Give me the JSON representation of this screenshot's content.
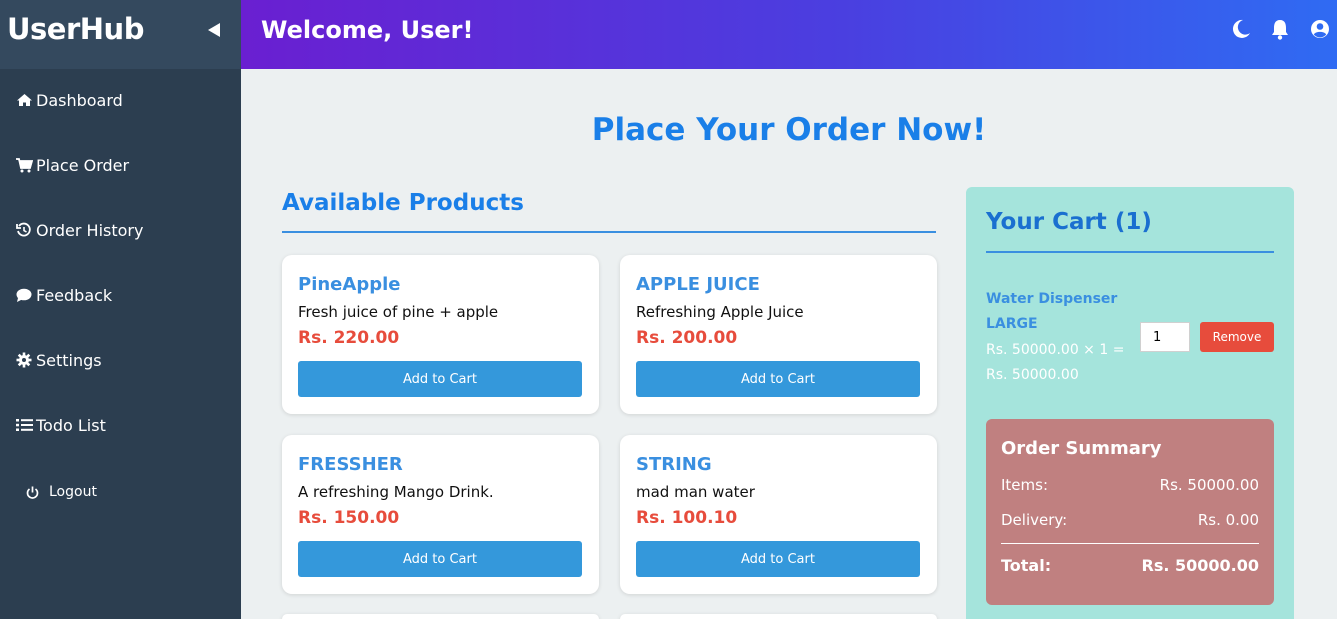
{
  "app": {
    "brand": "UserHub",
    "welcome": "Welcome, User!"
  },
  "sidebar": {
    "items": [
      {
        "label": "Dashboard",
        "icon": "home-icon"
      },
      {
        "label": "Place Order",
        "icon": "cart-icon"
      },
      {
        "label": "Order History",
        "icon": "history-icon"
      },
      {
        "label": "Feedback",
        "icon": "comment-icon"
      },
      {
        "label": "Settings",
        "icon": "gear-icon"
      },
      {
        "label": "Todo List",
        "icon": "list-icon"
      }
    ],
    "logout": {
      "label": "Logout",
      "icon": "power-icon"
    }
  },
  "topbar": {
    "icons": [
      "moon-icon",
      "bell-icon",
      "user-circle-icon"
    ]
  },
  "main": {
    "title": "Place Your Order Now!",
    "products_title": "Available Products",
    "add_label": "Add to Cart",
    "products": [
      {
        "name": "PineApple",
        "desc": "Fresh juice of pine + apple",
        "price": "Rs. 220.00"
      },
      {
        "name": "APPLE JUICE",
        "desc": "Refreshing Apple Juice",
        "price": "Rs. 200.00"
      },
      {
        "name": "FRESSHER",
        "desc": "A refreshing Mango Drink.",
        "price": "Rs. 150.00"
      },
      {
        "name": "STRING",
        "desc": "mad man water",
        "price": "Rs. 100.10"
      }
    ]
  },
  "cart": {
    "title": "Your Cart (1)",
    "item": {
      "name_line1": "Water Dispenser",
      "name_line2": "LARGE",
      "price_line1": "Rs. 50000.00 × 1 =",
      "price_line2": "Rs. 50000.00",
      "qty": "1",
      "remove_label": "Remove"
    },
    "summary": {
      "title": "Order Summary",
      "items_label": "Items:",
      "items_value": "Rs. 50000.00",
      "delivery_label": "Delivery:",
      "delivery_value": "Rs. 0.00",
      "total_label": "Total:",
      "total_value": "Rs. 50000.00"
    }
  },
  "colors": {
    "sidebar": "#2c3e50",
    "accent": "#1a7fe8",
    "price": "#e74c3c",
    "button": "#3498db",
    "cart_bg": "#a5e4dc",
    "summary_bg": "#c08080"
  }
}
